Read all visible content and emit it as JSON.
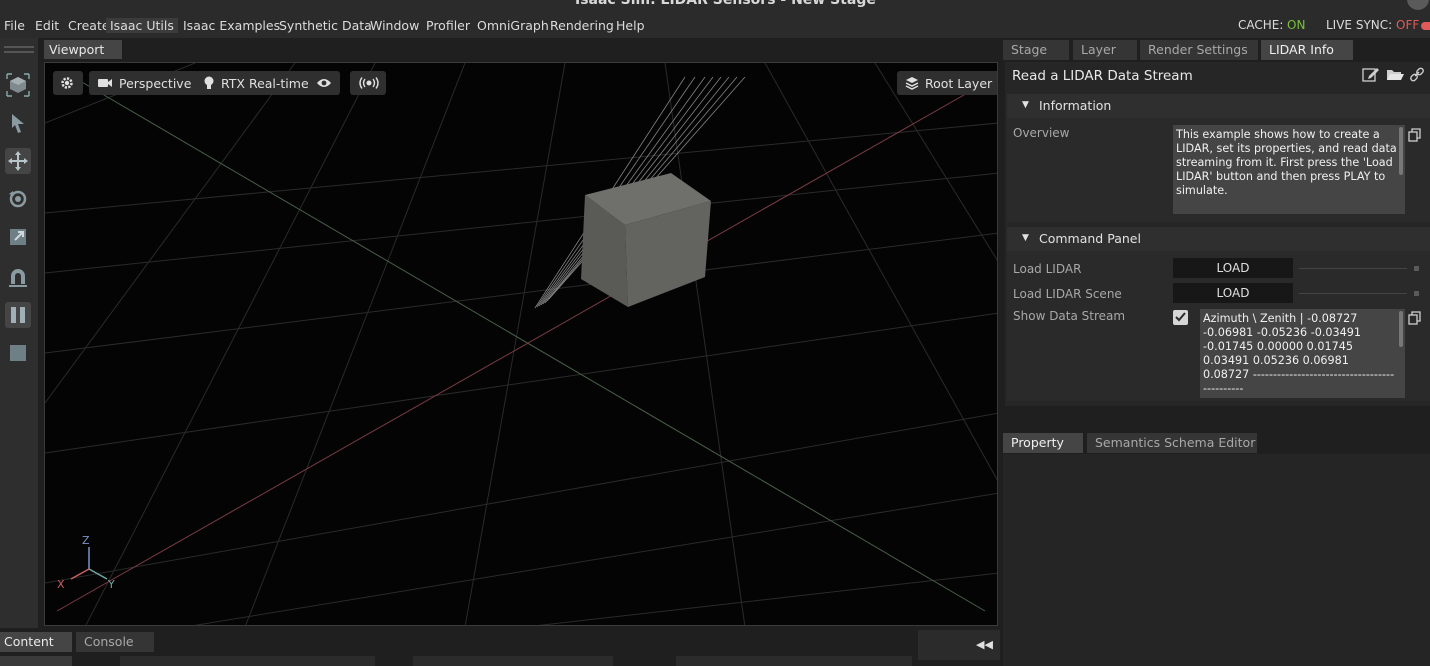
{
  "window": {
    "title": "Isaac Sim: LIDAR Sensors - New Stage"
  },
  "menu": {
    "items": [
      "File",
      "Edit",
      "Create",
      "Isaac Utils",
      "Isaac Examples",
      "Synthetic Data",
      "Window",
      "Profiler",
      "OmniGraph",
      "Rendering",
      "Help"
    ],
    "cache_label": "CACHE:",
    "cache_value": "ON",
    "live_sync_label": "LIVE SYNC:",
    "live_sync_value": "OFF",
    "on_color": "#77c23a",
    "off_color": "#e05a5a"
  },
  "toolbar": {
    "tools": [
      "select-mode-icon",
      "select-arrow-icon",
      "move-icon",
      "rotate-icon",
      "scale-icon",
      "snap-icon",
      "pause-icon",
      "stop-icon"
    ]
  },
  "viewport": {
    "tab_label": "Viewport",
    "settings_icon": "gear-icon",
    "camera_label": "Perspective",
    "render_label": "RTX Real-time",
    "visibility_icon": "eye-icon",
    "sensor_icon": "broadcast-icon",
    "layer_label": "Root Layer",
    "axes": {
      "z": "Z",
      "x": "X",
      "y": "Y"
    }
  },
  "right_tabs": [
    "Stage",
    "Layer",
    "Render Settings",
    "LIDAR Info"
  ],
  "lidar_panel": {
    "title": "Read a LIDAR Data Stream",
    "information": {
      "header": "Information",
      "overview_label": "Overview",
      "overview_text": "This example shows how to create a LIDAR, set its properties, and read data streaming from it. First press the 'Load LIDAR' button and then press PLAY to simulate."
    },
    "command_panel": {
      "header": "Command Panel",
      "load_lidar_label": "Load LIDAR",
      "load_lidar_button": "LOAD",
      "load_scene_label": "Load LIDAR Scene",
      "load_scene_button": "LOAD",
      "show_stream_label": "Show Data Stream",
      "show_stream_checked": true,
      "stream_text": "Azimuth \\ Zenith   |       -0.08727  -0.06981   -0.05236   -0.03491  -0.01745   0.00000   0.01745   0.03491   0.05236   0.06981   0.08727 ---------------------------------------------"
    }
  },
  "property_tabs": [
    "Property",
    "Semantics Schema Editor"
  ],
  "bottom_tabs": [
    "Content",
    "Console"
  ]
}
